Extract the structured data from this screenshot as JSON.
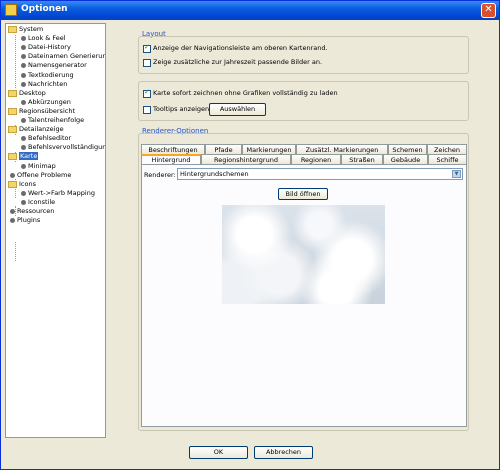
{
  "window": {
    "title": "Optionen"
  },
  "tree": [
    {
      "label": "System",
      "type": "folder",
      "level": 0
    },
    {
      "label": "Look & Feel",
      "type": "leaf",
      "level": 1
    },
    {
      "label": "Datei-History",
      "type": "leaf",
      "level": 1
    },
    {
      "label": "Dateinamen Generierung",
      "type": "leaf",
      "level": 1
    },
    {
      "label": "Namensgenerator",
      "type": "leaf",
      "level": 1
    },
    {
      "label": "Textkodierung",
      "type": "leaf",
      "level": 1
    },
    {
      "label": "Nachrichten",
      "type": "leaf",
      "level": 1
    },
    {
      "label": "Desktop",
      "type": "folder",
      "level": 0
    },
    {
      "label": "Abkürzungen",
      "type": "leaf",
      "level": 1
    },
    {
      "label": "Regionsübersicht",
      "type": "folder",
      "level": 0
    },
    {
      "label": "Talentreihenfolge",
      "type": "leaf",
      "level": 1
    },
    {
      "label": "Detailanzeige",
      "type": "folder",
      "level": 0
    },
    {
      "label": "Befehlseditor",
      "type": "leaf",
      "level": 1
    },
    {
      "label": "Befehlsvervollständigung",
      "type": "leaf",
      "level": 1
    },
    {
      "label": "Karte",
      "type": "folder",
      "level": 0,
      "selected": true
    },
    {
      "label": "Minimap",
      "type": "leaf",
      "level": 1
    },
    {
      "label": "Offene Probleme",
      "type": "leaf",
      "level": 0
    },
    {
      "label": "Icons",
      "type": "folder",
      "level": 0
    },
    {
      "label": "Wert->Farb Mapping",
      "type": "leaf",
      "level": 1
    },
    {
      "label": "Iconstile",
      "type": "leaf",
      "level": 1
    },
    {
      "label": "Ressourcen",
      "type": "leaf",
      "level": 0
    },
    {
      "label": "Plugins",
      "type": "leaf",
      "level": 0
    }
  ],
  "layout": {
    "title": "Layout",
    "cb_navbar": "Anzeige der Navigationsleiste am oberen Kartenrand.",
    "cb_navbar_checked": true,
    "cb_season": "Zeige zusätzliche zur Jahreszeit passende Bilder an.",
    "cb_season_checked": false
  },
  "misc": {
    "cb_draw": "Karte sofort zeichnen ohne Grafiken vollständig zu laden",
    "cb_draw_checked": true,
    "cb_tooltips": "Tooltips anzeigen",
    "cb_tooltips_checked": false,
    "select_button": "Auswählen"
  },
  "renderer": {
    "title": "Renderer-Optionen",
    "tabs_row1": [
      "Beschriftungen",
      "Pfade",
      "Markierungen",
      "Zusätzl. Markierungen",
      "Schemen",
      "Zeichen"
    ],
    "tabs_row2": [
      "Hintergrund",
      "Regionshintergrund",
      "Regionen",
      "Straßen",
      "Gebäude",
      "Schiffe"
    ],
    "active_tab": "Hintergrund",
    "renderer_label": "Renderer:",
    "renderer_value": "Hintergrundschemen",
    "open_image": "Bild öffnen"
  },
  "footer": {
    "ok": "OK",
    "cancel": "Abbrechen"
  },
  "colors": {
    "titlebar": "#0a5ce0",
    "selection": "#316ac5",
    "group_title": "#2a56c8",
    "active_tab_accent": "#f5a623"
  }
}
